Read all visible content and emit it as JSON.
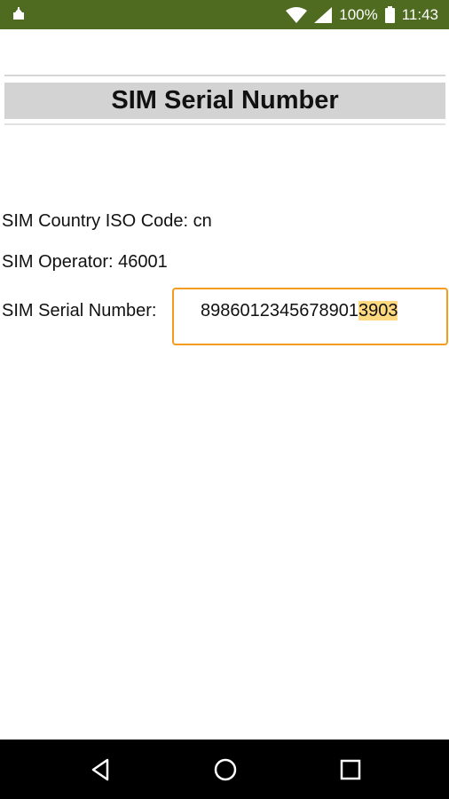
{
  "status_bar": {
    "battery_percent": "100%",
    "time": "11:43",
    "icons": [
      "notification-icon",
      "wifi-icon",
      "signal-icon",
      "battery-icon"
    ],
    "background_color": "#4e6b1f"
  },
  "header": {
    "title": "SIM Serial Number"
  },
  "info": {
    "country_iso_label": "SIM Country ISO Code: cn",
    "operator_label": "SIM Operator: 46001",
    "serial_label": "SIM Serial Number:",
    "serial_value_prefix": "8986012345678901",
    "serial_value_highlight": "3903"
  },
  "nav_bar": {
    "icons": [
      "back-icon",
      "home-icon",
      "recents-icon"
    ]
  },
  "colors": {
    "accent": "#f39c1f",
    "highlight": "#ffd980",
    "title_background": "#d3d3d3"
  }
}
